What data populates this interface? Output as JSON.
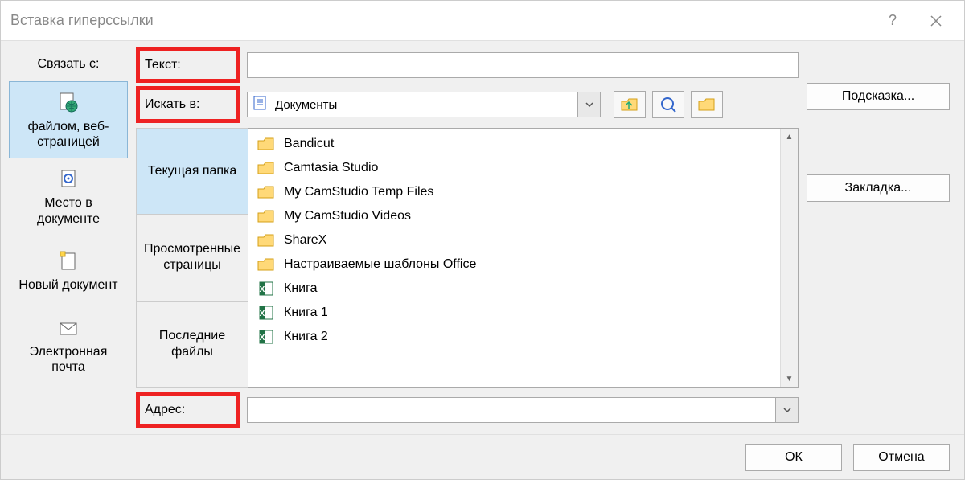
{
  "title": "Вставка гиперссылки",
  "linkto_label": "Связать с:",
  "left_buttons": [
    {
      "label": "файлом, веб-страницей",
      "selected": true,
      "icon": "page-globe"
    },
    {
      "label": "Место в документе",
      "selected": false,
      "icon": "doc-target"
    },
    {
      "label": "Новый документ",
      "selected": false,
      "icon": "new-doc"
    },
    {
      "label": "Электронная почта",
      "selected": false,
      "icon": "mail"
    }
  ],
  "text_label": "Текст:",
  "text_value": "",
  "search_label": "Искать в:",
  "search_value": "Документы",
  "mid_tabs": [
    {
      "label": "Текущая папка",
      "selected": true
    },
    {
      "label": "Просмотренные страницы",
      "selected": false
    },
    {
      "label": "Последние файлы",
      "selected": false
    }
  ],
  "files": [
    {
      "name": "Bandicut",
      "type": "folder"
    },
    {
      "name": "Camtasia Studio",
      "type": "folder"
    },
    {
      "name": "My CamStudio Temp Files",
      "type": "folder"
    },
    {
      "name": "My CamStudio Videos",
      "type": "folder"
    },
    {
      "name": "ShareX",
      "type": "folder"
    },
    {
      "name": "Настраиваемые шаблоны Office",
      "type": "folder"
    },
    {
      "name": "Книга",
      "type": "excel"
    },
    {
      "name": "Книга 1",
      "type": "excel"
    },
    {
      "name": "Книга 2",
      "type": "excel"
    }
  ],
  "address_label": "Адрес:",
  "address_value": "",
  "buttons": {
    "hint": "Подсказка...",
    "bookmark": "Закладка...",
    "ok": "ОК",
    "cancel": "Отмена"
  }
}
